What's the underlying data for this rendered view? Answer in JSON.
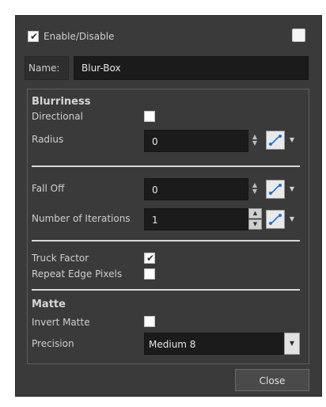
{
  "header": {
    "enable_label": "Enable/Disable",
    "enable_checked": true,
    "color_swatch": "#ffffff"
  },
  "name": {
    "label": "Name:",
    "value": "Blur-Box"
  },
  "blurriness": {
    "heading": "Blurriness",
    "directional_label": "Directional",
    "directional_checked": false,
    "radius_label": "Radius",
    "radius_value": "0"
  },
  "falloff": {
    "falloff_label": "Fall Off",
    "falloff_value": "0",
    "iterations_label": "Number of Iterations",
    "iterations_value": "1"
  },
  "truck": {
    "truck_label": "Truck Factor",
    "truck_checked": true,
    "repeat_label": "Repeat Edge Pixels",
    "repeat_checked": false
  },
  "matte": {
    "heading": "Matte",
    "invert_label": "Invert Matte",
    "invert_checked": false,
    "precision_label": "Precision",
    "precision_value": "Medium 8"
  },
  "footer": {
    "close_label": "Close"
  },
  "icons": {
    "checkmark": "✔",
    "spin": "up-down-arrows",
    "function": "function-curve-icon",
    "dropdown": "triangle-down"
  },
  "colors": {
    "dialog_bg": "#3a3a3a",
    "field_bg": "#1b1b1b",
    "text": "#d8d8d8"
  }
}
